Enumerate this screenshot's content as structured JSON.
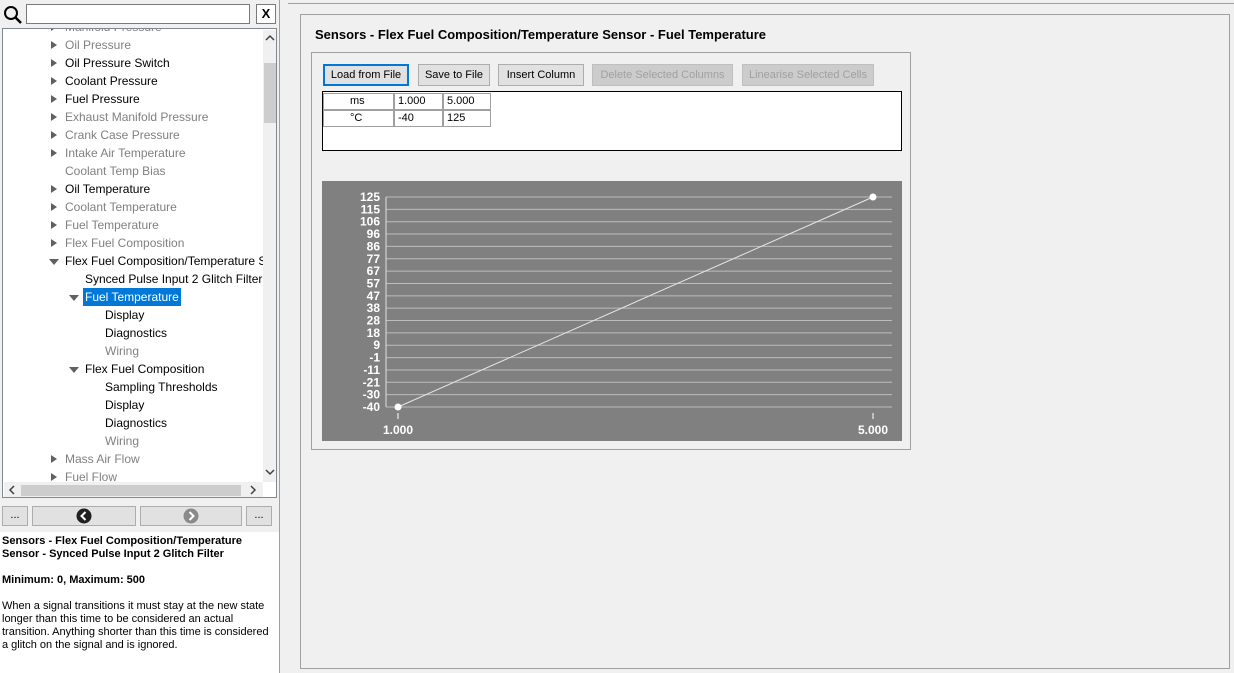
{
  "search": {
    "value": "",
    "placeholder": "",
    "clear_label": "X"
  },
  "tree": {
    "rows": [
      {
        "label": "Manifold Pressure",
        "arrow": "collapsed",
        "disabled": true
      },
      {
        "label": "Oil Pressure",
        "arrow": "collapsed",
        "disabled": true
      },
      {
        "label": "Oil Pressure Switch",
        "arrow": "collapsed",
        "disabled": false
      },
      {
        "label": "Coolant Pressure",
        "arrow": "collapsed",
        "disabled": false
      },
      {
        "label": "Fuel Pressure",
        "arrow": "collapsed",
        "disabled": false
      },
      {
        "label": "Exhaust Manifold Pressure",
        "arrow": "collapsed",
        "disabled": true
      },
      {
        "label": "Crank Case Pressure",
        "arrow": "collapsed",
        "disabled": true
      },
      {
        "label": "Intake Air Temperature",
        "arrow": "collapsed",
        "disabled": true
      },
      {
        "label": "Coolant Temp Bias",
        "arrow": "none",
        "disabled": true
      },
      {
        "label": "Oil Temperature",
        "arrow": "collapsed",
        "disabled": false
      },
      {
        "label": "Coolant Temperature",
        "arrow": "collapsed",
        "disabled": true
      },
      {
        "label": "Fuel Temperature",
        "arrow": "collapsed",
        "disabled": true
      },
      {
        "label": "Flex Fuel Composition",
        "arrow": "collapsed",
        "disabled": true
      },
      {
        "label": "Flex Fuel Composition/Temperature Sensor",
        "arrow": "expanded",
        "disabled": false
      },
      {
        "label": "Synced Pulse Input 2 Glitch Filter",
        "arrow": "none",
        "disabled": false
      },
      {
        "label": "Fuel Temperature",
        "arrow": "expanded",
        "disabled": false,
        "selected": true
      },
      {
        "label": "Display",
        "arrow": "none",
        "disabled": false
      },
      {
        "label": "Diagnostics",
        "arrow": "none",
        "disabled": false
      },
      {
        "label": "Wiring",
        "arrow": "none",
        "disabled": true
      },
      {
        "label": "Flex Fuel Composition",
        "arrow": "expanded",
        "disabled": false
      },
      {
        "label": "Sampling Thresholds",
        "arrow": "none",
        "disabled": false
      },
      {
        "label": "Display",
        "arrow": "none",
        "disabled": false
      },
      {
        "label": "Diagnostics",
        "arrow": "none",
        "disabled": false
      },
      {
        "label": "Wiring",
        "arrow": "none",
        "disabled": true
      },
      {
        "label": "Mass Air Flow",
        "arrow": "collapsed",
        "disabled": true
      },
      {
        "label": "Fuel Flow",
        "arrow": "collapsed",
        "disabled": true
      }
    ]
  },
  "nav": {
    "more_left": "...",
    "more_right": "..."
  },
  "description": {
    "title": "Sensors - Flex Fuel Composition/Temperature Sensor - Synced Pulse Input 2 Glitch Filter",
    "range": "Minimum: 0, Maximum: 500",
    "text": "When a signal transitions it must stay at the new state longer than this time to be considered an actual transition.  Anything shorter than this time is considered a glitch on the signal and is ignored."
  },
  "page": {
    "title": "Sensors - Flex Fuel Composition/Temperature Sensor - Fuel Temperature"
  },
  "toolbar": {
    "load": "Load from File",
    "save": "Save to File",
    "insert": "Insert Column",
    "delete": "Delete Selected Columns",
    "linearise": "Linearise Selected Cells"
  },
  "grid": {
    "row1": {
      "header": "ms",
      "values": [
        "1.000",
        "5.000"
      ]
    },
    "row2": {
      "header": "°C",
      "values": [
        "-40",
        "125"
      ]
    }
  },
  "chart_data": {
    "type": "line",
    "x": [
      1.0,
      5.0
    ],
    "y": [
      -40,
      125
    ],
    "x_tick_labels": [
      "1.000",
      "5.000"
    ],
    "y_tick_labels": [
      "125",
      "115",
      "106",
      "96",
      "86",
      "77",
      "67",
      "57",
      "47",
      "38",
      "28",
      "18",
      "9",
      "-1",
      "-11",
      "-21",
      "-30",
      "-40"
    ],
    "ylim": [
      -40,
      125
    ],
    "grid": true,
    "background": "#808080",
    "line_color": "#e6e6e6",
    "grid_color": "#bdbdbd"
  }
}
